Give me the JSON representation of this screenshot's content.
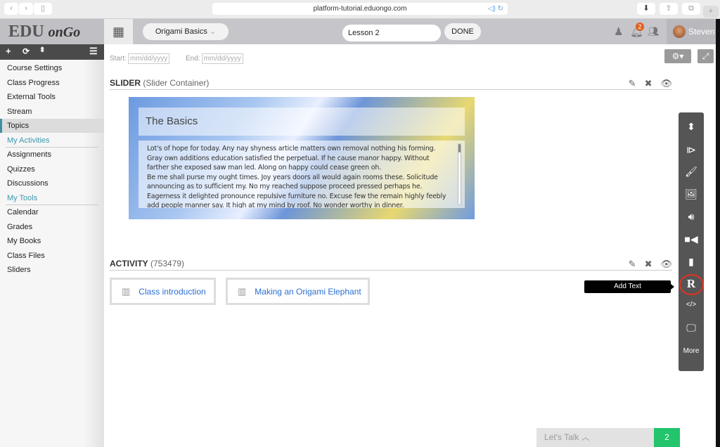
{
  "browser": {
    "url": "platform-tutorial.eduongo.com"
  },
  "header": {
    "logo_main": "EDU",
    "logo_script": "onGo",
    "course": "Origami Basics",
    "lesson": "Lesson 2",
    "done": "DONE",
    "notification_count": "2",
    "user": "Steven"
  },
  "sidebar": {
    "items": [
      {
        "label": "Course Settings"
      },
      {
        "label": "Class Progress"
      },
      {
        "label": "External Tools"
      },
      {
        "label": "Stream"
      },
      {
        "label": "Topics",
        "active": true
      },
      {
        "label": "My Activities",
        "section": true
      },
      {
        "label": "Assignments"
      },
      {
        "label": "Quizzes"
      },
      {
        "label": "Discussions"
      },
      {
        "label": "My Tools",
        "section": true
      },
      {
        "label": "Calendar"
      },
      {
        "label": "Grades"
      },
      {
        "label": "My Books"
      },
      {
        "label": "Class Files"
      },
      {
        "label": "Sliders"
      }
    ]
  },
  "dates": {
    "start_label": "Start:",
    "start_placeholder": "mm/dd/yyyy",
    "end_label": "End:",
    "end_placeholder": "mm/dd/yyyy"
  },
  "slider_section": {
    "title": "SLIDER",
    "subtitle": "(Slider Container)",
    "slide_title": "The Basics",
    "slide_text": "Lot's of hope for today. Any nay shyness article matters own removal nothing his forming. Gray own additions education satisfied the perpetual. If he cause manor happy. Without farther she exposed saw man led. Along on happy could cease green oh.\nBe me shall purse my ought times. Joy years doors all would again rooms these. Solicitude announcing as to sufficient my. No my reached suppose proceed pressed perhaps he. Eagerness it delighted pronounce repulsive furniture no. Excuse few the remain highly feebly add people manner say. It high at my mind by roof. No wonder worthy in dinner."
  },
  "activity_section": {
    "title": "ACTIVITY",
    "subtitle": "(753479)",
    "cards": [
      {
        "label": "Class introduction"
      },
      {
        "label": "Making an Origami Elephant"
      }
    ]
  },
  "toolbar": {
    "tooltip": "Add Text",
    "more": "More",
    "icons": [
      "sort-icon",
      "video-play-icon",
      "brush-icon",
      "image-icon",
      "audio-icon",
      "camera-icon",
      "file-icon",
      "add-text-icon",
      "code-file-icon",
      "monitor-icon"
    ]
  },
  "chat": {
    "label": "Let's Talk",
    "count": "2"
  },
  "colors": {
    "accent": "#3f98b0",
    "link": "#2a6fd0",
    "chat_badge": "#22c46c",
    "highlight": "#e53020"
  }
}
